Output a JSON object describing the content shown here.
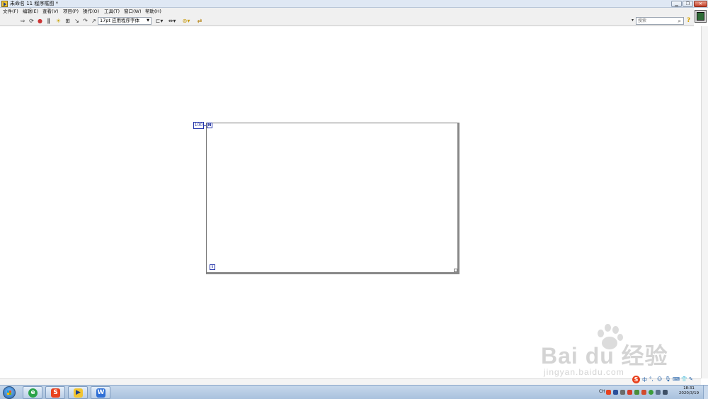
{
  "window": {
    "title": "未命名 11 程序框图 *",
    "controls": [
      "minimize-icon",
      "restore-icon",
      "close-icon"
    ]
  },
  "menubar": {
    "items": [
      "文件(F)",
      "编辑(E)",
      "查看(V)",
      "项目(P)",
      "操作(O)",
      "工具(T)",
      "窗口(W)",
      "帮助(H)"
    ]
  },
  "toolbar": {
    "tools": [
      "run-arrow-icon",
      "run-continuously-icon",
      "abort-icon",
      "pause-icon",
      "highlight-execution-icon",
      "retain-wire-values-icon",
      "step-into-icon",
      "step-over-icon",
      "step-out-icon"
    ],
    "font": "17pt 应用程序字体",
    "arrange_tools": [
      "align-objects-icon",
      "distribute-objects-icon",
      "reorder-icon",
      "cleanup-diagram-icon"
    ],
    "search_placeholder": "搜索"
  },
  "diagram": {
    "loop_count_constant": "100",
    "count_terminal": "N",
    "iteration_terminal": "i"
  },
  "taskbar": {
    "apps": [
      "ie-browser-icon",
      "sogou-input-icon",
      "labview-icon",
      "wps-icon"
    ],
    "tray": {
      "language": "CH"
    },
    "clock": {
      "time": "18:31",
      "date": "2020/3/19"
    }
  },
  "watermark": {
    "main": "Bai du 经验",
    "sub": "jingyan.baidu.com"
  }
}
